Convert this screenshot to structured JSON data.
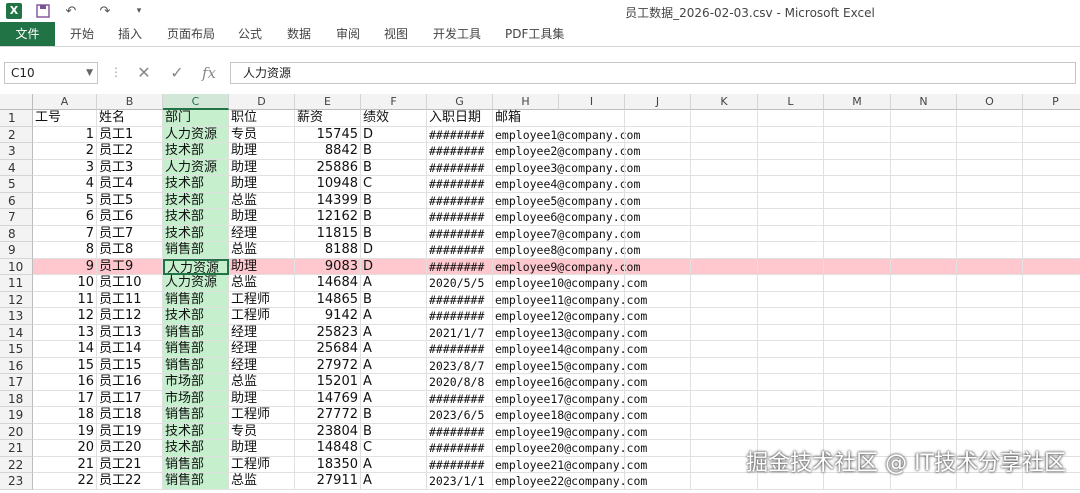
{
  "app": {
    "title": "员工数据_2026-02-03.csv - Microsoft Excel",
    "logo": "X",
    "qa": {
      "save": "save-icon",
      "undo": "undo-icon",
      "redo": "redo-icon",
      "customize": "customize-icon"
    }
  },
  "ribbon": {
    "tabs": [
      "文件",
      "开始",
      "插入",
      "页面布局",
      "公式",
      "数据",
      "审阅",
      "视图",
      "开发工具",
      "PDF工具集"
    ],
    "file_color": "#217346"
  },
  "formula_bar": {
    "name_box": "C10",
    "fx": "fx",
    "cancel_icon": "✕",
    "enter_icon": "✓",
    "value": "人力资源"
  },
  "sheet": {
    "columns": [
      "A",
      "B",
      "C",
      "D",
      "E",
      "F",
      "G",
      "H",
      "I",
      "J",
      "K",
      "L",
      "M",
      "N",
      "O",
      "P"
    ],
    "selected_column": "C",
    "active_row": 10,
    "header_row": [
      "工号",
      "姓名",
      "部门",
      "职位",
      "薪资",
      "绩效",
      "入职日期",
      "邮箱"
    ],
    "rows": [
      [
        "1",
        "员工1",
        "人力资源",
        "专员",
        "15745",
        "D",
        "########",
        "employee1@company.com"
      ],
      [
        "2",
        "员工2",
        "技术部",
        "助理",
        "8842",
        "B",
        "########",
        "employee2@company.com"
      ],
      [
        "3",
        "员工3",
        "人力资源",
        "助理",
        "25886",
        "B",
        "########",
        "employee3@company.com"
      ],
      [
        "4",
        "员工4",
        "技术部",
        "助理",
        "10948",
        "C",
        "########",
        "employee4@company.com"
      ],
      [
        "5",
        "员工5",
        "技术部",
        "总监",
        "14399",
        "B",
        "########",
        "employee5@company.com"
      ],
      [
        "6",
        "员工6",
        "技术部",
        "助理",
        "12162",
        "B",
        "########",
        "employee6@company.com"
      ],
      [
        "7",
        "员工7",
        "技术部",
        "经理",
        "11815",
        "B",
        "########",
        "employee7@company.com"
      ],
      [
        "8",
        "员工8",
        "销售部",
        "总监",
        "8188",
        "D",
        "########",
        "employee8@company.com"
      ],
      [
        "9",
        "员工9",
        "人力资源",
        "助理",
        "9083",
        "D",
        "########",
        "employee9@company.com"
      ],
      [
        "10",
        "员工10",
        "人力资源",
        "总监",
        "14684",
        "A",
        "2020/5/5",
        "employee10@company.com"
      ],
      [
        "11",
        "员工11",
        "销售部",
        "工程师",
        "14865",
        "B",
        "########",
        "employee11@company.com"
      ],
      [
        "12",
        "员工12",
        "技术部",
        "工程师",
        "9142",
        "A",
        "########",
        "employee12@company.com"
      ],
      [
        "13",
        "员工13",
        "销售部",
        "经理",
        "25823",
        "A",
        "2021/1/7",
        "employee13@company.com"
      ],
      [
        "14",
        "员工14",
        "销售部",
        "经理",
        "25684",
        "A",
        "########",
        "employee14@company.com"
      ],
      [
        "15",
        "员工15",
        "销售部",
        "经理",
        "27972",
        "A",
        "2023/8/7",
        "employee15@company.com"
      ],
      [
        "16",
        "员工16",
        "市场部",
        "总监",
        "15201",
        "A",
        "2020/8/8",
        "employee16@company.com"
      ],
      [
        "17",
        "员工17",
        "市场部",
        "助理",
        "14769",
        "A",
        "########",
        "employee17@company.com"
      ],
      [
        "18",
        "员工18",
        "销售部",
        "工程师",
        "27772",
        "B",
        "2023/6/5",
        "employee18@company.com"
      ],
      [
        "19",
        "员工19",
        "技术部",
        "专员",
        "23804",
        "B",
        "########",
        "employee19@company.com"
      ],
      [
        "20",
        "员工20",
        "技术部",
        "助理",
        "14848",
        "C",
        "########",
        "employee20@company.com"
      ],
      [
        "21",
        "员工21",
        "销售部",
        "工程师",
        "18350",
        "A",
        "########",
        "employee21@company.com"
      ],
      [
        "22",
        "员工22",
        "销售部",
        "总监",
        "27911",
        "A",
        "2023/1/1",
        "employee22@company.com"
      ]
    ],
    "highlight_color": "#ffc7ce",
    "dept_fill_color": "#c6efce"
  },
  "watermark": "掘金技术社区 @ IT技术分享社区"
}
